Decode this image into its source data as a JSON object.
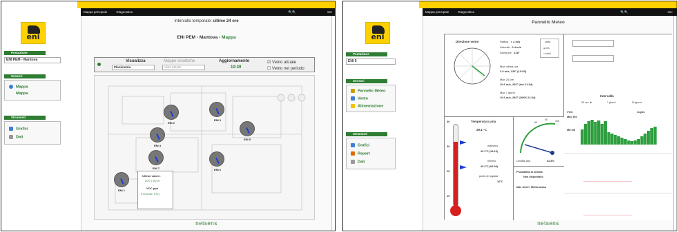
{
  "left": {
    "topbar": {
      "home": "Mappa principale",
      "diag": "Diagnostica",
      "user": "Ser"
    },
    "brand": "eni",
    "postazione": {
      "header": "Postazione",
      "value": "ENI PEM - Mantova"
    },
    "sensori": {
      "header": "Sensori",
      "items": [
        "Mappa",
        "Mappa"
      ]
    },
    "strumenti": {
      "header": "Strumenti",
      "items": [
        "Grafici",
        "Dati"
      ]
    },
    "interval": {
      "label": "Intervallo temporale:",
      "value": "ultime 24 ore"
    },
    "title": {
      "site": "ENI PEM - Mantova",
      "sep": " - ",
      "page": "Mappa"
    },
    "controls": {
      "visualizza": "Visualizza",
      "visualizza_val": "Planimetria",
      "mappa": "Mappe sinottiche",
      "mappa_val": "Vista attuale",
      "aggiorn": "Aggiornamento",
      "aggiorn_val": "10:39",
      "vento_attuale": "Vento attuale",
      "vento_periodo": "Vento nel periodo"
    },
    "stations": [
      "ENI 2",
      "ENI 3",
      "ENI 4",
      "ENI 5",
      "ENI 6",
      "ENI 7",
      "ENI 1"
    ],
    "popup": {
      "t1": "Ultimo valore:",
      "t2": "20/7 | 20/19",
      "t3": "VOC ppb",
      "t4": "974 (max: 972)"
    },
    "footer": "netsens"
  },
  "right": {
    "topbar": {
      "home": "Mappa principale",
      "diag": "Diagnostica",
      "user": "Ser"
    },
    "brand": "eni",
    "postazione": {
      "header": "Postazione",
      "value": "ENI 5"
    },
    "sensori": {
      "header": "Sensori",
      "items": [
        "Pannello Meteo",
        "Vento",
        "Alimentazione"
      ]
    },
    "strumenti": {
      "header": "Strumenti",
      "items": [
        "Grafici",
        "Report",
        "Dati"
      ]
    },
    "title": "Pannello Meteo",
    "wind": {
      "title": "Direzione vento",
      "raffica_l": "Raffica",
      "raffica_v": "< 2 m/s",
      "vel_l": "Velocità",
      "vel_v": "0.4 m/s",
      "dir_l": "Direzione",
      "dir_v": "128°",
      "unit_title": "Unità",
      "unit1": "m/s",
      "unit2": "km/h",
      "max1_l": "Max ultima ora",
      "max1_v": "2.0 m/s, 128° (13:53)",
      "max24_l": "Max 24 ore",
      "max24_v": "10.6 m/s, 282° (ieri 21:54)",
      "max7_l": "Max 7 giorni",
      "max7_v": "10.6 m/s, 282° (20/06 21:54)"
    },
    "interval": {
      "title": "Intervallo",
      "o1": "24 ore",
      "o2": "7 giorni",
      "o3": "30 giorni"
    },
    "voc": {
      "label": "VOC",
      "unit": "mg/m",
      "max": "Max 302",
      "min": "Min 98"
    },
    "temp": {
      "title": "Temperatura aria",
      "value": "29.1 °C",
      "max_l": "massimo",
      "max_v": "29.1°C (14:13)",
      "min_l": "minimo",
      "min_v": "20.2°C (06:09)",
      "dew_l": "punto di rugiada",
      "dew_v": "10°C",
      "scale": [
        "40",
        "30",
        "20",
        "10"
      ]
    },
    "humid": {
      "label": "Umidità aria",
      "value": "34.3%",
      "ticks": [
        "60",
        "80",
        "100"
      ]
    },
    "brina": {
      "title": "Probabilità di brinata",
      "v": "Non disponibile.",
      "ice_l": "Max di ieri:",
      "ice_v": "Molto bassa"
    },
    "footer": "netsens"
  }
}
